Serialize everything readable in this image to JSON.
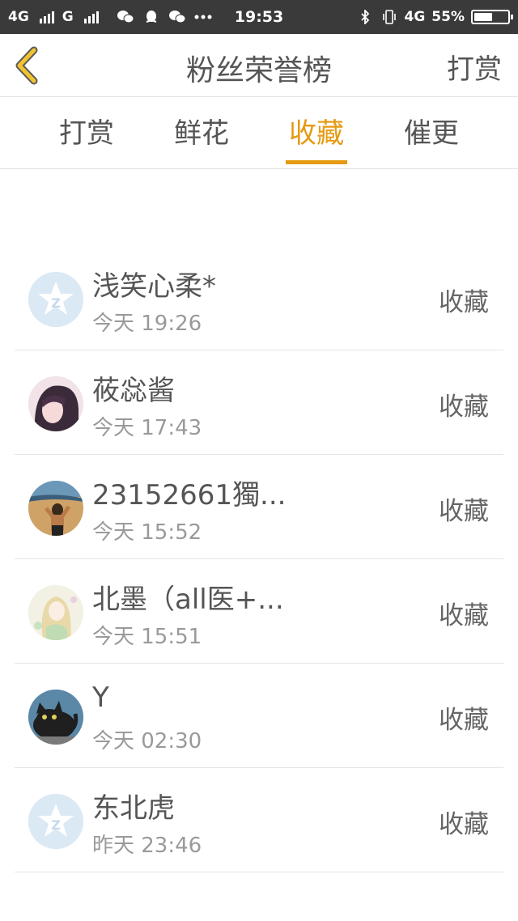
{
  "status_bar": {
    "net1": "4G",
    "net2": "G",
    "time": "19:53",
    "net3": "4G",
    "battery": "55%",
    "battery_level": 0.55,
    "icons": [
      "wechat-icon",
      "qq-icon",
      "wechat-icon",
      "more-dots-icon",
      "bluetooth-icon",
      "vibrate-icon"
    ]
  },
  "header": {
    "title": "粉丝荣誉榜",
    "action_label": "打赏"
  },
  "tabs": [
    {
      "label": "打赏",
      "active": false
    },
    {
      "label": "鲜花",
      "active": false
    },
    {
      "label": "收藏",
      "active": true
    },
    {
      "label": "催更",
      "active": false
    }
  ],
  "accent_color": "#e59a12",
  "list": [
    {
      "name": "浅笑心柔*",
      "time": "今天 19:26",
      "action": "收藏"
    },
    {
      "name": "莜惢酱",
      "time": "今天 17:43",
      "action": "收藏"
    },
    {
      "name": "23152661獨...",
      "time": "今天 15:52",
      "action": "收藏"
    },
    {
      "name": "北墨（all医+...",
      "time": "今天 15:51",
      "action": "收藏"
    },
    {
      "name": "Y",
      "time": "今天 02:30",
      "action": "收藏"
    },
    {
      "name": "东北虎",
      "time": "昨天 23:46",
      "action": "收藏"
    }
  ]
}
